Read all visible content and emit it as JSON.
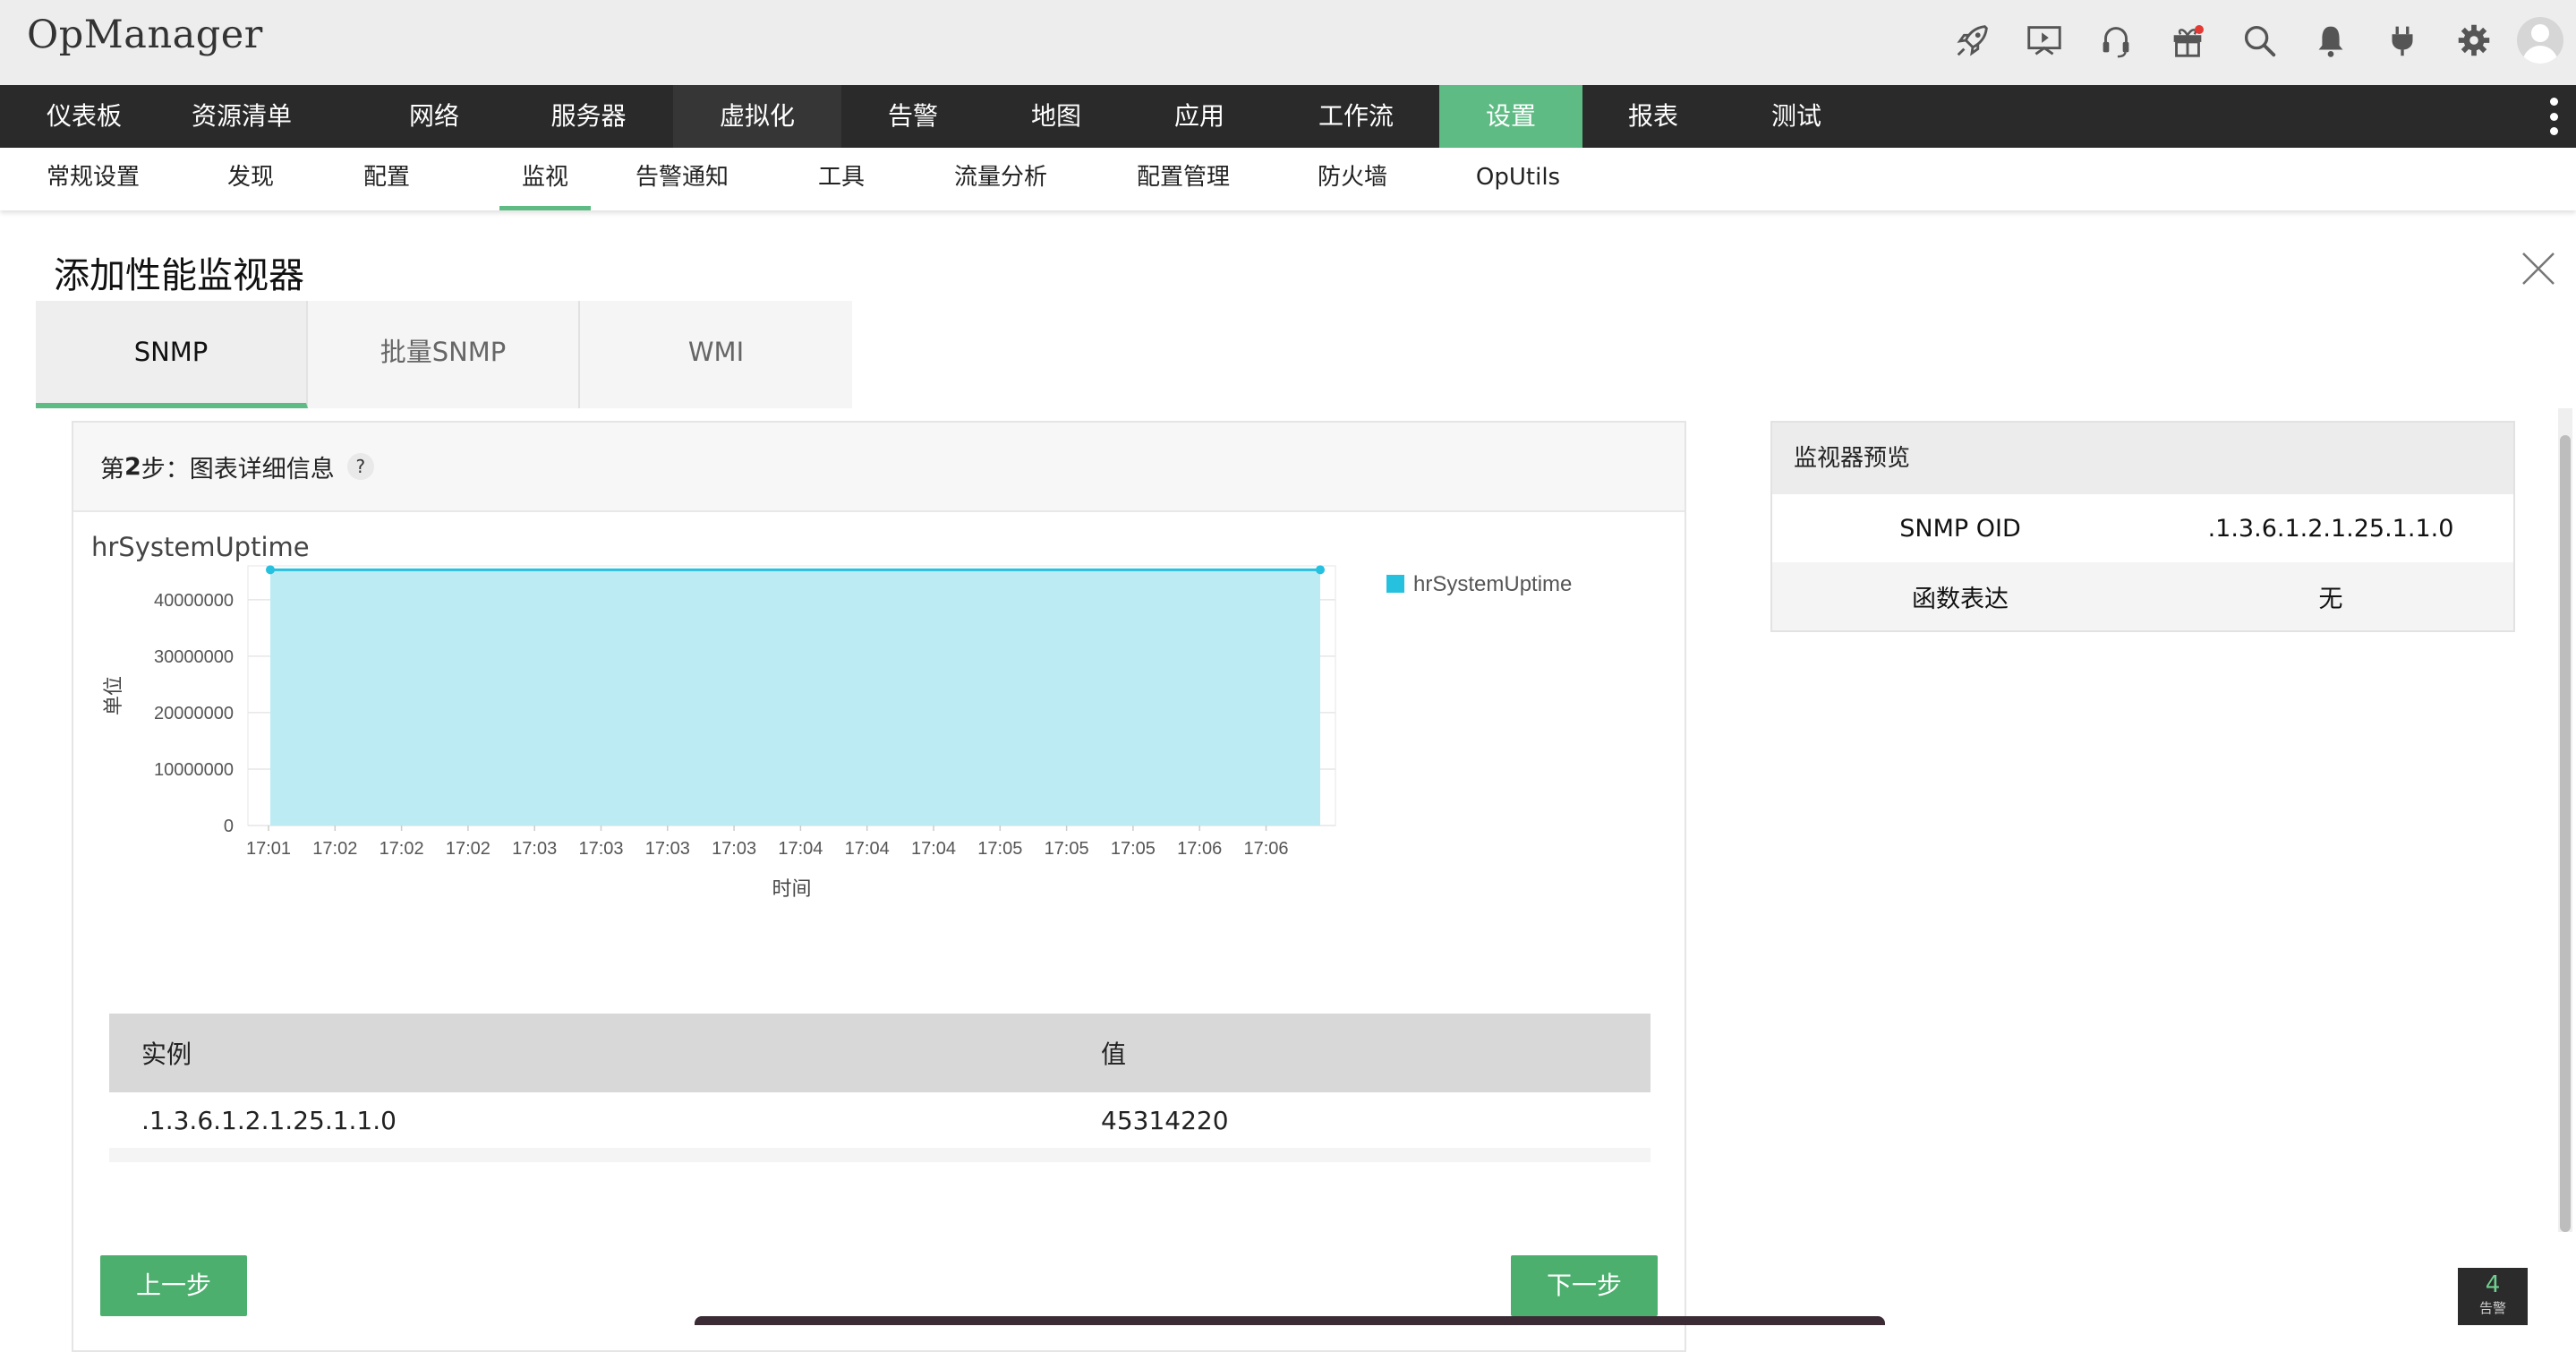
{
  "app": {
    "title": "OpManager"
  },
  "header_icons": [
    "rocket-icon",
    "presentation-icon",
    "headset-icon",
    "gift-icon",
    "search-icon",
    "bell-icon",
    "plug-icon",
    "gear-icon",
    "user-avatar-icon"
  ],
  "main_nav": {
    "items": [
      "仪表板",
      "资源清单",
      "网络",
      "服务器",
      "虚拟化",
      "告警",
      "地图",
      "应用",
      "工作流",
      "设置",
      "报表",
      "测试"
    ],
    "active": "设置",
    "hovered": "虚拟化"
  },
  "sub_nav": {
    "items": [
      "常规设置",
      "发现",
      "配置",
      "监视",
      "告警通知",
      "工具",
      "流量分析",
      "配置管理",
      "防火墙",
      "OpUtils"
    ],
    "active": "监视"
  },
  "page": {
    "title": "添加性能监视器"
  },
  "tabs": {
    "items": [
      "SNMP",
      "批量SNMP",
      "WMI"
    ],
    "active": "SNMP"
  },
  "step": {
    "prefix": "第",
    "number": "2",
    "suffix": "步：图表详细信息",
    "help": "?"
  },
  "chart_data": {
    "type": "area",
    "title": "hrSystemUptime",
    "xlabel": "时间",
    "ylabel": "单位",
    "x": [
      "17:01",
      "17:02",
      "17:02",
      "17:02",
      "17:03",
      "17:03",
      "17:03",
      "17:03",
      "17:04",
      "17:04",
      "17:04",
      "17:05",
      "17:05",
      "17:05",
      "17:06",
      "17:06"
    ],
    "series": [
      {
        "name": "hrSystemUptime",
        "values": [
          45314220,
          45314220
        ]
      }
    ],
    "yticks": [
      "0",
      "10000000",
      "20000000",
      "30000000",
      "40000000"
    ],
    "ylim": [
      0,
      46000000
    ],
    "legend": "top-right",
    "grid": true,
    "color": "#27c1e0",
    "fill": "#bdebf4"
  },
  "table": {
    "headers": [
      "实例",
      "值"
    ],
    "rows": [
      [
        ".1.3.6.1.2.1.25.1.1.0",
        "45314220"
      ]
    ]
  },
  "buttons": {
    "prev": "上一步",
    "next": "下一步"
  },
  "preview": {
    "title": "监视器预览",
    "rows": [
      {
        "label": "SNMP OID",
        "value": ".1.3.6.1.2.1.25.1.1.0"
      },
      {
        "label": "函数表达",
        "value": "无"
      }
    ]
  },
  "alarm": {
    "count": "4",
    "label": "告警"
  },
  "colors": {
    "accent": "#5fbb84",
    "nav_bg": "#2a2a2a",
    "button": "#4caf6e"
  }
}
